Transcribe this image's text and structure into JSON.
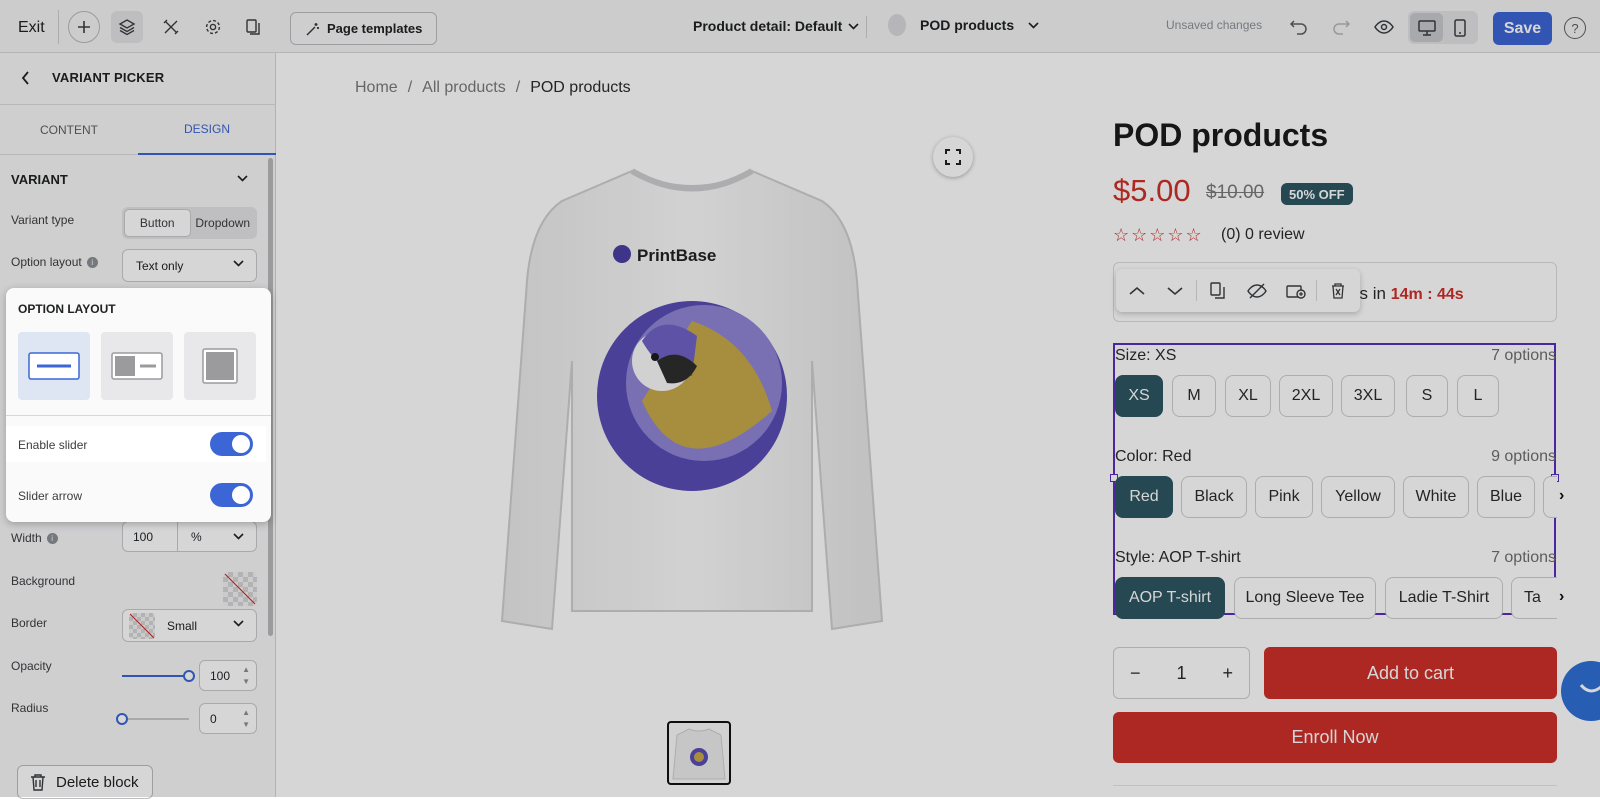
{
  "topbar": {
    "exit_label": "Exit",
    "page_templates_label": "Page templates",
    "page_selector": "Product detail: Default",
    "product_selector": "POD products",
    "unsaved_text": "Unsaved changes",
    "save_label": "Save",
    "help_label": "?"
  },
  "sidebar": {
    "title": "VARIANT PICKER",
    "tabs": [
      "CONTENT",
      "DESIGN"
    ],
    "section_title": "VARIANT",
    "variant_type_label": "Variant type",
    "variant_type_options": [
      "Button",
      "Dropdown"
    ],
    "option_layout_label": "Option layout",
    "option_layout_value": "Text only",
    "popup": {
      "title": "OPTION LAYOUT",
      "enable_slider_label": "Enable slider",
      "slider_arrow_label": "Slider arrow"
    },
    "width_label": "Width",
    "width_value": "100",
    "width_unit": "%",
    "background_label": "Background",
    "border_label": "Border",
    "border_value": "Small",
    "opacity_label": "Opacity",
    "opacity_value": "100",
    "radius_label": "Radius",
    "radius_value": "0",
    "delete_label": "Delete block"
  },
  "canvas": {
    "breadcrumb": [
      "Home",
      "/",
      "All products",
      "/",
      "POD products"
    ],
    "image_logo_text": "PrintBase",
    "product_title": "POD products",
    "price": "$5.00",
    "old_price": "$10.00",
    "discount_badge": "50% OFF",
    "review_text": "(0) 0 review",
    "timer_prefix": "e ends in",
    "timer_value": "14m : 44s",
    "options": [
      {
        "label": "Size: XS",
        "count": "7 options",
        "values": [
          "XS",
          "M",
          "XL",
          "2XL",
          "3XL",
          "S",
          "L"
        ]
      },
      {
        "label": "Color: Red",
        "count": "9 options",
        "values": [
          "Red",
          "Black",
          "Pink",
          "Yellow",
          "White",
          "Blue"
        ]
      },
      {
        "label": "Style: AOP T-shirt",
        "count": "7 options",
        "values": [
          "AOP T-shirt",
          "Long Sleeve Tee",
          "Ladie T-Shirt",
          "Ta"
        ]
      }
    ],
    "quantity": "1",
    "qty_minus": "−",
    "qty_plus": "+",
    "add_to_cart": "Add to cart",
    "enroll": "Enroll Now"
  },
  "colors": {
    "accent": "#3c66d6",
    "brand_red": "#d0302a",
    "chip_selected": "#2d5662",
    "selection_outline": "#5b2dbf"
  }
}
